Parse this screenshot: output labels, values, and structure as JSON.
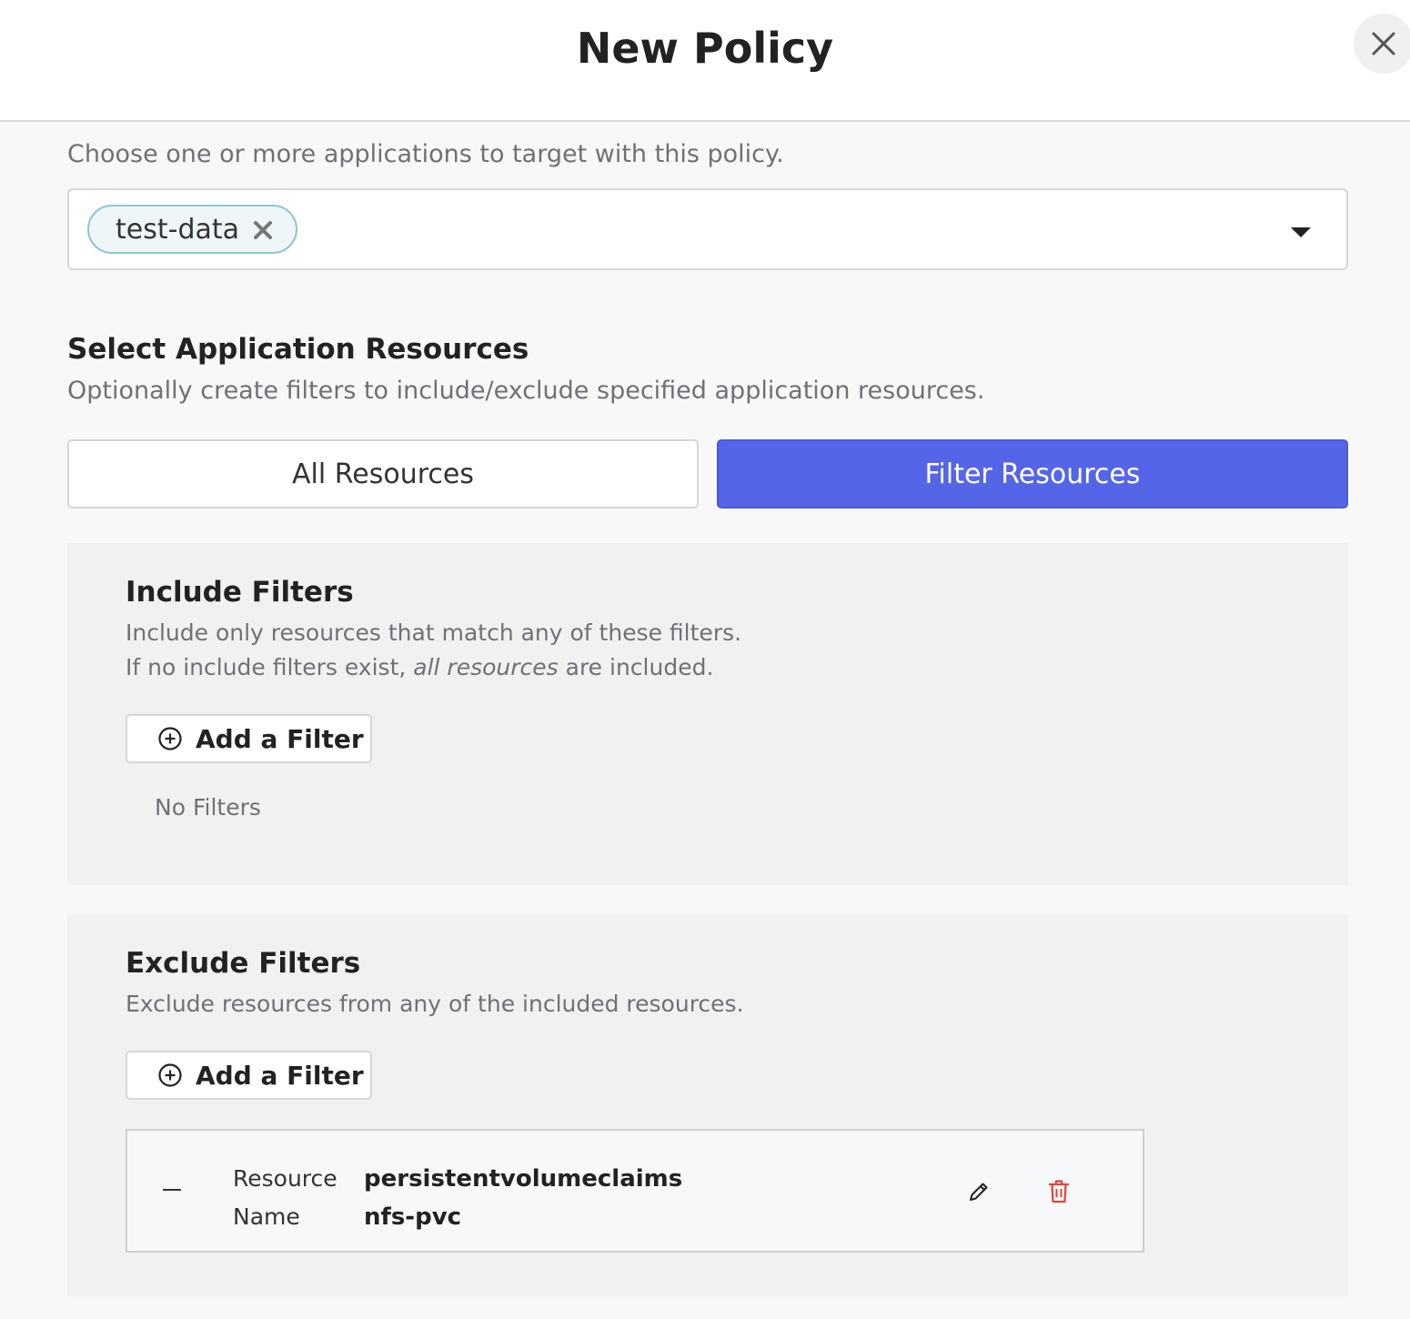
{
  "modal": {
    "title": "New Policy"
  },
  "applications": {
    "intro": "Choose one or more applications to target with this policy.",
    "selected": [
      "test-data"
    ]
  },
  "resources": {
    "title": "Select Application Resources",
    "description": "Optionally create filters to include/exclude specified application resources.",
    "options": [
      "All Resources",
      "Filter Resources"
    ],
    "selected_option": "Filter Resources"
  },
  "include_filters": {
    "title": "Include Filters",
    "description_line1": "Include only resources that match any of these filters.",
    "description_line2_pre": "If no include filters exist, ",
    "description_line2_em": "all resources",
    "description_line2_post": " are included.",
    "add_label": "Add a Filter",
    "empty_text": "No Filters"
  },
  "exclude_filters": {
    "title": "Exclude Filters",
    "description": "Exclude resources from any of the included resources.",
    "add_label": "Add a Filter",
    "items": [
      {
        "resource_key": "Resource",
        "resource_value": "persistentvolumeclaims",
        "name_key": "Name",
        "name_value": "nfs-pvc"
      }
    ]
  },
  "icons": {
    "close": "close-icon",
    "chip_remove": "remove-icon",
    "dropdown": "caret-down-icon",
    "add": "plus-circle-icon",
    "collapse": "minus-icon",
    "edit": "pencil-icon",
    "delete": "trash-icon"
  },
  "colors": {
    "primary": "#5565e8",
    "chip_border": "#8fc6cf",
    "danger": "#e0443e",
    "muted_text": "#6e7177"
  }
}
